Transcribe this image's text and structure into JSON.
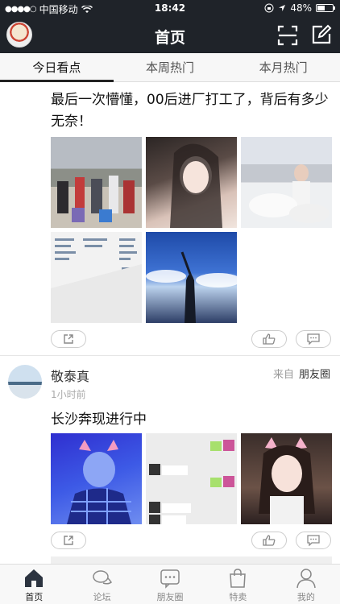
{
  "status_bar": {
    "signal": "●●●●○",
    "carrier": "中国移动",
    "time": "18:42",
    "battery": "48%"
  },
  "header": {
    "title": "首页"
  },
  "tabs": [
    {
      "label": "今日看点",
      "active": true
    },
    {
      "label": "本周热门",
      "active": false
    },
    {
      "label": "本月热门",
      "active": false
    }
  ],
  "posts": [
    {
      "text": "最后一次懵懂，00后进厂打工了，背后有多少无奈！",
      "image_count": 5
    },
    {
      "author": "敬泰真",
      "time": "1小时前",
      "source_prefix": "来自",
      "source": "朋友圈",
      "text": "长沙奔现进行中",
      "image_count": 3
    }
  ],
  "bottom_nav": [
    {
      "label": "首页",
      "icon": "home-icon",
      "active": true
    },
    {
      "label": "论坛",
      "icon": "forum-icon",
      "active": false
    },
    {
      "label": "朋友圈",
      "icon": "moments-icon",
      "active": false
    },
    {
      "label": "特卖",
      "icon": "bag-icon",
      "active": false
    },
    {
      "label": "我的",
      "icon": "user-icon",
      "active": false
    }
  ],
  "colors": {
    "header_bg": "#1f2329",
    "active_tab": "#222222"
  }
}
